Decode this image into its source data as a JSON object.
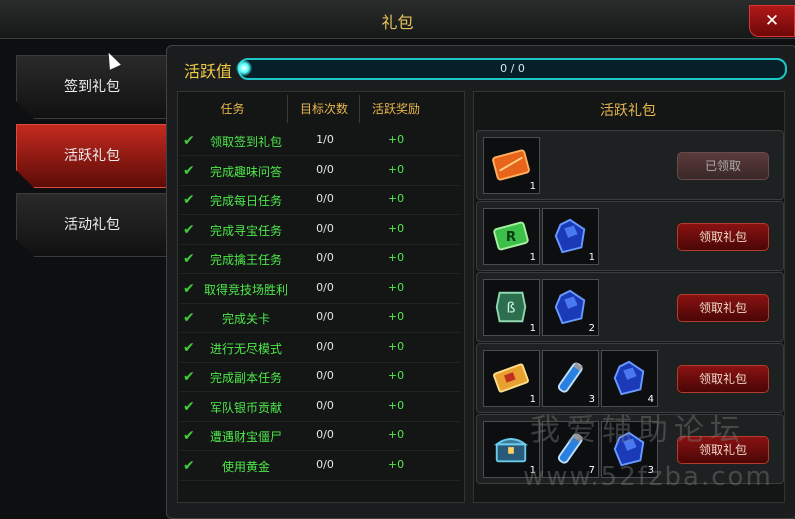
{
  "window": {
    "title": "礼包",
    "close_label": "✕"
  },
  "sidebar": {
    "tabs": [
      {
        "label": "签到礼包",
        "active": false
      },
      {
        "label": "活跃礼包",
        "active": true
      },
      {
        "label": "活动礼包",
        "active": false
      }
    ]
  },
  "activity": {
    "label": "活跃值",
    "progress_text": "0 / 0",
    "progress_fraction": 0
  },
  "tasks": {
    "headers": {
      "task": "任务",
      "target": "目标次数",
      "reward": "活跃奖励"
    },
    "rows": [
      {
        "name": "领取签到礼包",
        "count": "1/0",
        "reward": "+0"
      },
      {
        "name": "完成趣味问答",
        "count": "0/0",
        "reward": "+0"
      },
      {
        "name": "完成每日任务",
        "count": "0/0",
        "reward": "+0"
      },
      {
        "name": "完成寻宝任务",
        "count": "0/0",
        "reward": "+0"
      },
      {
        "name": "完成擒王任务",
        "count": "0/0",
        "reward": "+0"
      },
      {
        "name": "取得竞技场胜利",
        "count": "0/0",
        "reward": "+0"
      },
      {
        "name": "完成关卡",
        "count": "0/0",
        "reward": "+0"
      },
      {
        "name": "进行无尽模式",
        "count": "0/0",
        "reward": "+0"
      },
      {
        "name": "完成副本任务",
        "count": "0/0",
        "reward": "+0"
      },
      {
        "name": "军队银币贡献",
        "count": "0/0",
        "reward": "+0"
      },
      {
        "name": "遭遇财宝僵尸",
        "count": "0/0",
        "reward": "+0"
      },
      {
        "name": "使用黄金",
        "count": "0/0",
        "reward": "+0"
      }
    ]
  },
  "gifts": {
    "title": "活跃礼包",
    "rows": [
      {
        "items": [
          {
            "icon": "orange-card-icon",
            "count": "1"
          }
        ],
        "button": "已领取",
        "claimed": true
      },
      {
        "items": [
          {
            "icon": "green-r-card-icon",
            "count": "1"
          },
          {
            "icon": "blue-gem-icon",
            "count": "1"
          }
        ],
        "button": "领取礼包",
        "claimed": false
      },
      {
        "items": [
          {
            "icon": "green-rune-icon",
            "count": "1"
          },
          {
            "icon": "blue-gem-icon",
            "count": "2"
          }
        ],
        "button": "领取礼包",
        "claimed": false
      },
      {
        "items": [
          {
            "icon": "gold-ticket-icon",
            "count": "1"
          },
          {
            "icon": "blue-potion-icon",
            "count": "3"
          },
          {
            "icon": "blue-gem-icon",
            "count": "4"
          }
        ],
        "button": "领取礼包",
        "claimed": false
      },
      {
        "items": [
          {
            "icon": "treasure-chest-icon",
            "count": "1"
          },
          {
            "icon": "blue-potion-icon",
            "count": "7"
          },
          {
            "icon": "blue-gem-icon",
            "count": "3"
          }
        ],
        "button": "领取礼包",
        "claimed": false
      }
    ]
  },
  "watermark": {
    "line1": "我爱辅助论坛",
    "line2": "www.52fzba.com"
  },
  "colors": {
    "accent_gold": "#e8b64d",
    "task_green": "#4ee84a",
    "progress_cyan": "#27d6d6",
    "active_tab_red": "#c42a1f"
  }
}
